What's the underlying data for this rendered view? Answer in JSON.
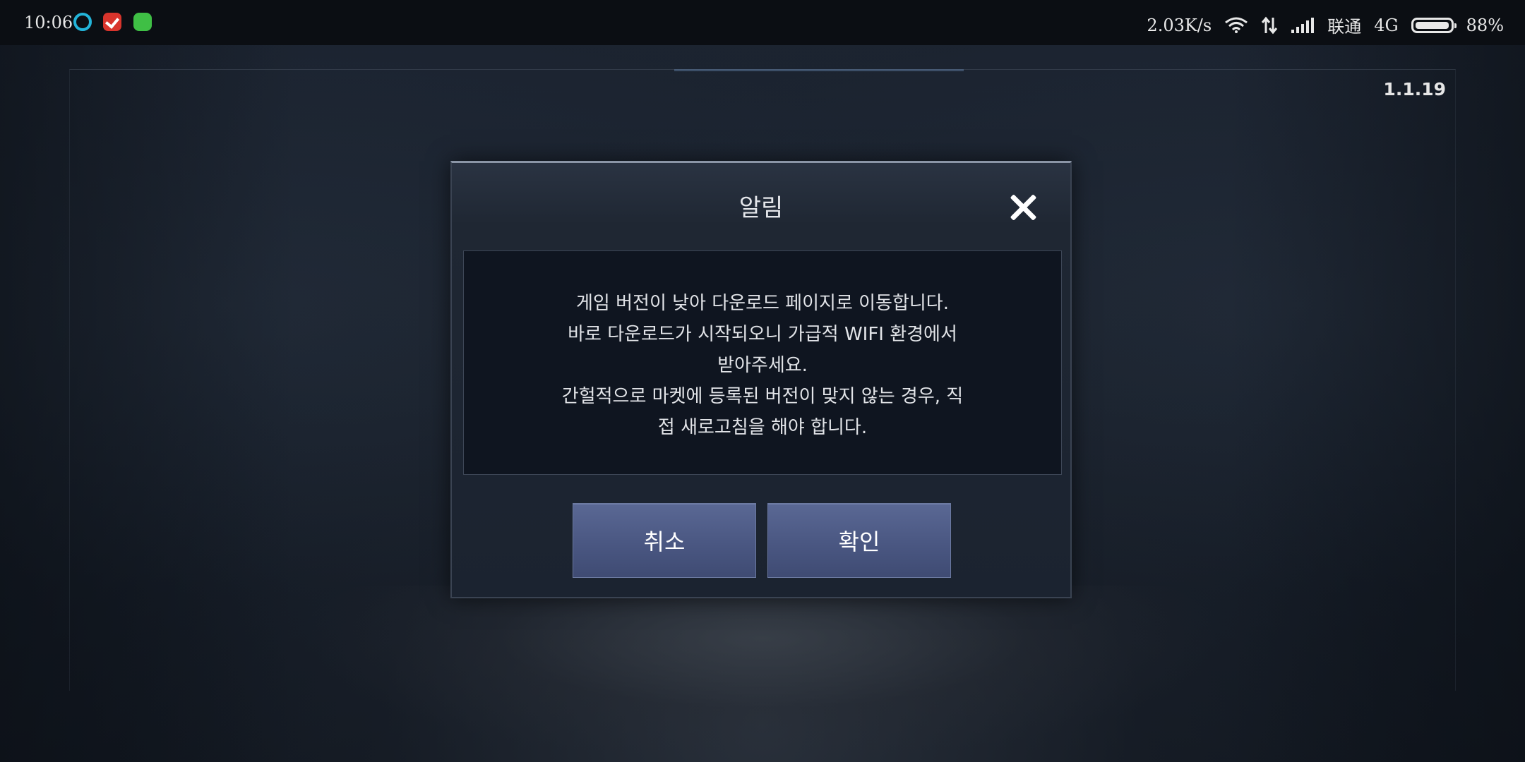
{
  "status_bar": {
    "time": "10:06",
    "network_speed": "2.03K/s",
    "carrier": "联通",
    "network_type": "4G",
    "battery": "88%",
    "battery_level": 0.88,
    "icons": [
      "app-icon-blue-ring",
      "app-icon-red-check",
      "app-icon-green-face",
      "wifi-icon",
      "data-arrows-icon",
      "signal-icon",
      "battery-icon"
    ]
  },
  "game": {
    "version": "1.1.19"
  },
  "dialog": {
    "title": "알림",
    "message_lines": [
      "게임 버전이 낮아 다운로드 페이지로 이동합니다.",
      "바로 다운로드가 시작되오니 가급적 WIFI 환경에서",
      "받아주세요.",
      "간헐적으로 마켓에 등록된 버전이 맞지 않는 경우, 직",
      "접 새로고침을 해야 합니다."
    ],
    "cancel_label": "취소",
    "confirm_label": "확인"
  }
}
